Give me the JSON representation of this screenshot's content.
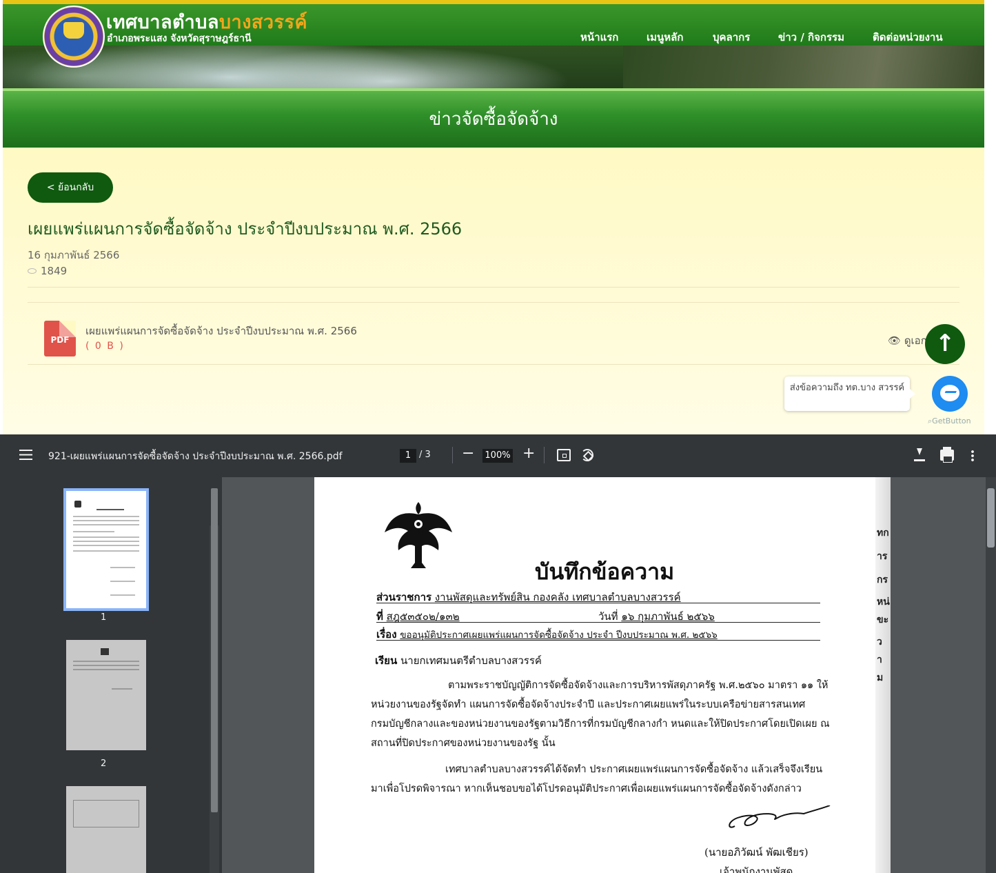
{
  "site": {
    "title_main": "เทศบาลตำบล",
    "title_accent": "บางสวรรค์",
    "subtitle": "อำเภอพระแสง จังหวัดสุราษฎร์ธานี",
    "nav": [
      "หน้าแรก",
      "เมนูหลัก",
      "บุคลากร",
      "ข่าว / กิจกรรม",
      "ติดต่อหน่วยงาน"
    ]
  },
  "banner": {
    "title": "ข่าวจัดซื้อจัดจ้าง"
  },
  "article": {
    "back_label": "< ย้อนกลับ",
    "title": "เผยแพร่แผนการจัดซื้อจัดจ้าง ประจำปีงบประมาณ พ.ศ. 2566",
    "date": "16 กุมภาพันธ์ 2566",
    "views": "1849",
    "attachment": {
      "icon_label": "PDF",
      "name": "เผยแพร่แผนการจัดซื้อจัดจ้าง ประจำปีงบประมาณ พ.ศ. 2566",
      "size": "( 0 B )",
      "view_label": "ดูเอก"
    }
  },
  "chat": {
    "bubble_text": "ส่งข้อความถึง ทต.บาง สวรรค์",
    "getbutton": "GetButton"
  },
  "pdf_viewer": {
    "filename": "921-เผยแพร่แผนการจัดซื้อจัดจ้าง ประจำปีงบประมาณ พ.ศ. 2566.pdf",
    "current_page": "1",
    "total_pages": "/ 3",
    "zoom": "100%",
    "thumbnails": [
      "1",
      "2"
    ],
    "page": {
      "title": "บันทึกข้อความ",
      "agency_label": "ส่วนราชการ",
      "agency": "งานพัสดุและทรัพย์สิน กองคลัง เทศบาลตำบลบางสวรรค์",
      "ref_label": "ที่",
      "ref": "สฎ๕๓๕๐๒/๑๓๒",
      "date_label": "วันที่",
      "date": "๑๖ กุมภาพันธ์ ๒๕๖๖",
      "subject_label": "เรื่อง",
      "subject": "ขออนุมัติประกาศเผยแพร่แผนการจัดซื้อจัดจ้าง ประจำ ปีงบประมาณ พ.ศ. ๒๕๖๖",
      "to_label": "เรียน",
      "to": "นายกเทศมนตรีตำบลบางสวรรค์",
      "para1": [
        "ตามพระราชบัญญัติการจัดซื้อจัดจ้างและการบริหารพัสดุภาครัฐ พ.ศ.๒๕๖๐ มาตรา ๑๑ ให้",
        "หน่วยงานของรัฐจัดทำ แผนการจัดซื้อจัดจ้างประจำปี และประกาศเผยแพร่ในระบบเครือข่ายสารสนเทศ",
        "กรมบัญชีกลางและของหน่วยงานของรัฐตามวิธีการที่กรมบัญชีกลางกำ หนดและให้ปิดประกาศโดยเปิดเผย ณ",
        "สถานที่ปิดประกาศของหน่วยงานของรัฐ นั้น"
      ],
      "para2": [
        "เทศบาลตำบลบางสวรรค์ได้จัดทำ ประกาศเผยแพร่แผนการจัดซื้อจัดจ้าง แล้วเสร็จจึงเรียน",
        "มาเพื่อโปรดพิจารณา หากเห็นชอบขอได้โปรดอนุมัติประกาศเพื่อเผยแพร่แผนการจัดซื้อจัดจ้างดังกล่าว"
      ],
      "signer": "(นายอภิวัฒน์ พัฒเชียร)",
      "position": "เจ้าพนักงานพัสดุ",
      "edge_chars": [
        "ทก",
        "าร",
        "กร",
        "หน่",
        "ขะ",
        "ว",
        "า",
        "ม"
      ]
    }
  }
}
